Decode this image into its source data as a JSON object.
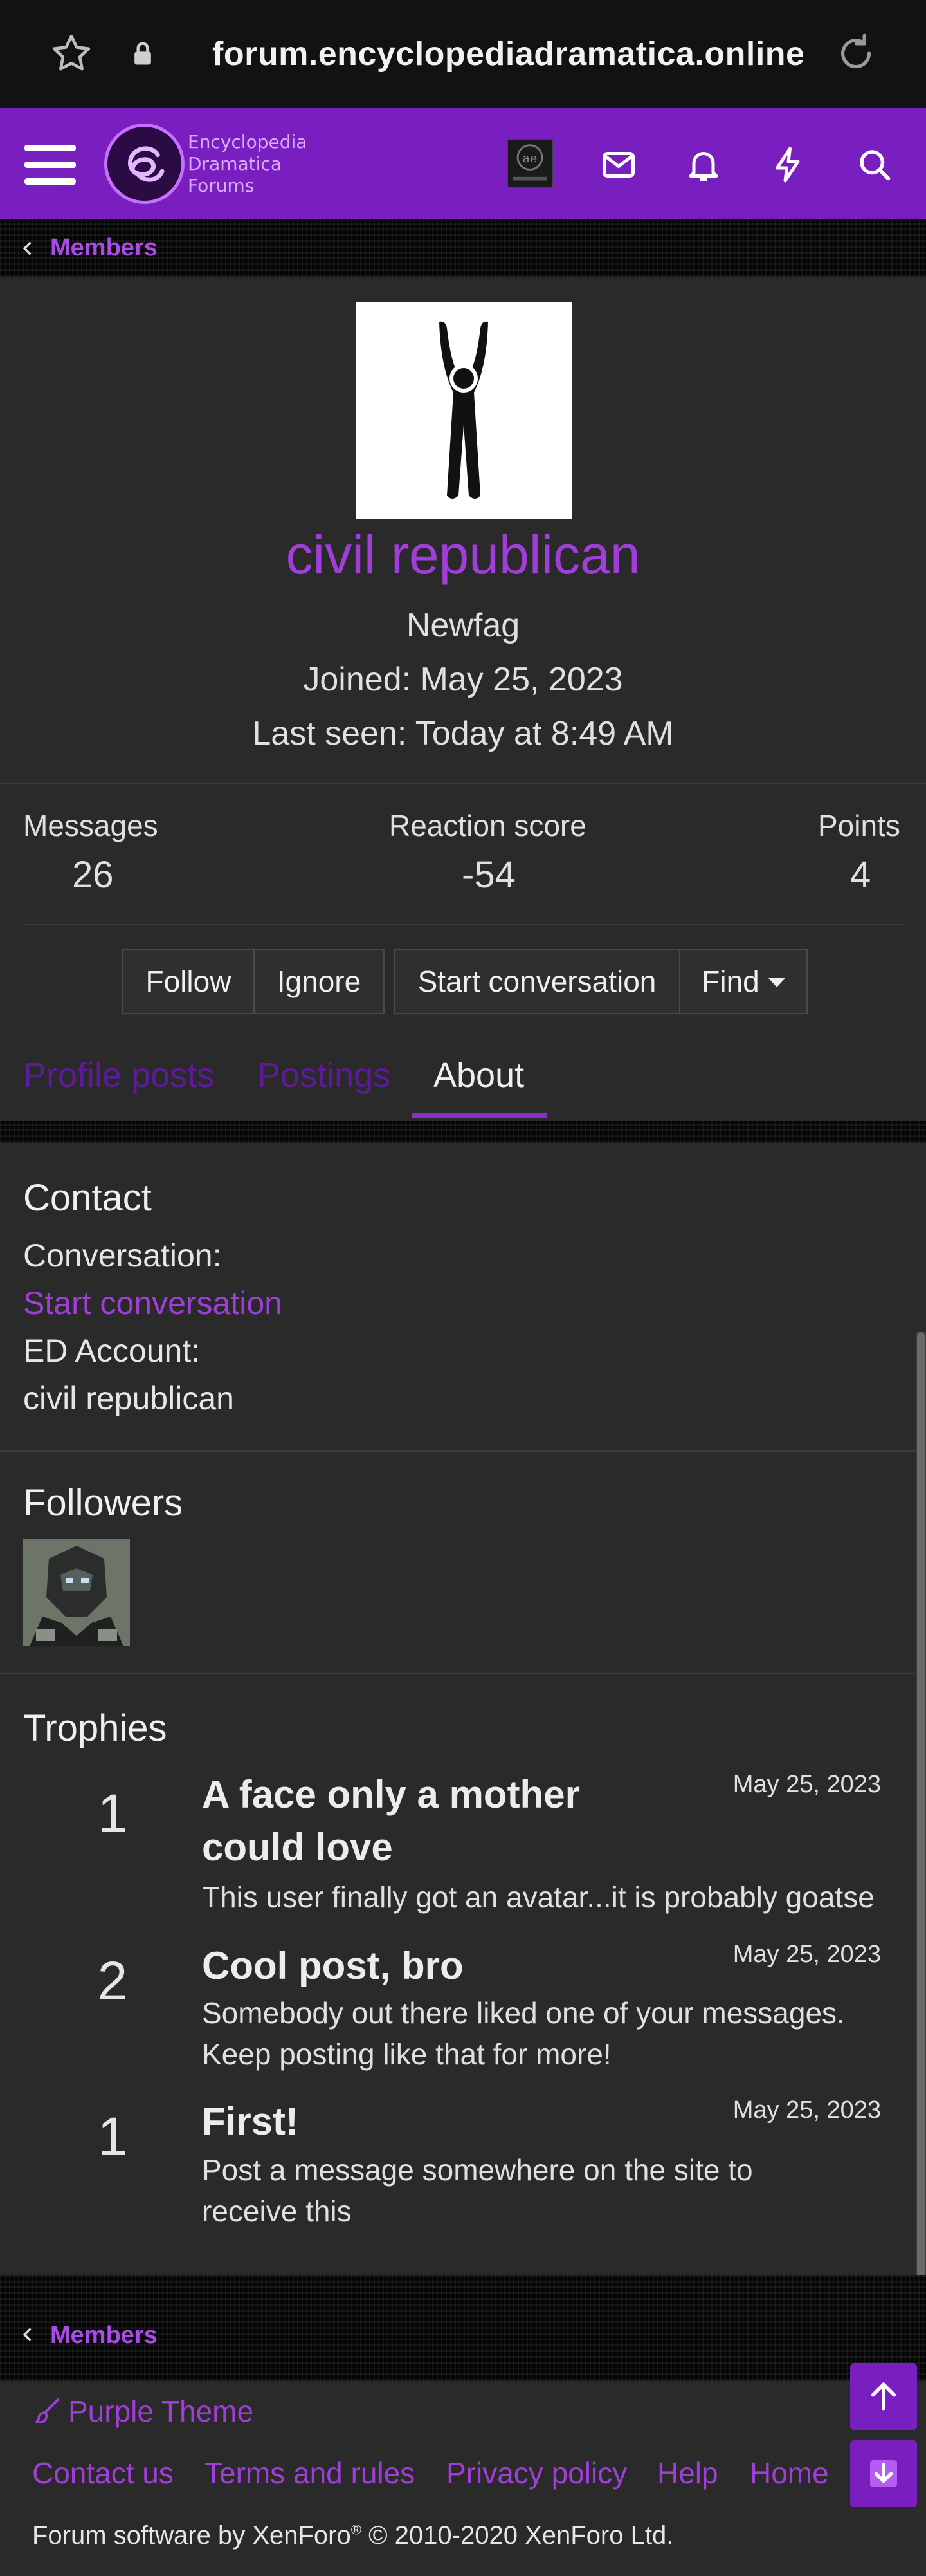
{
  "browser": {
    "url": "forum.encyclopediadramatica.online"
  },
  "header": {
    "logo_lines": [
      "Encyclopedia",
      "Dramatica",
      "Forums"
    ],
    "logo_mark": "ae"
  },
  "breadcrumb": {
    "label": "Members"
  },
  "profile": {
    "username": "civil republican",
    "user_title": "Newfag",
    "joined": "Joined: May 25, 2023",
    "last_seen": "Last seen: Today at 8:49 AM",
    "stats": [
      {
        "label": "Messages",
        "value": "26"
      },
      {
        "label": "Reaction score",
        "value": "-54"
      },
      {
        "label": "Points",
        "value": "4"
      }
    ]
  },
  "actions": {
    "follow": "Follow",
    "ignore": "Ignore",
    "start_conversation": "Start conversation",
    "find": "Find"
  },
  "tabs": [
    {
      "label": "Profile posts",
      "active": false
    },
    {
      "label": "Postings",
      "active": false
    },
    {
      "label": "About",
      "active": true
    }
  ],
  "contact": {
    "title": "Contact",
    "conversation_label": "Conversation:",
    "conversation_link": "Start conversation",
    "ed_account_label": "ED Account:",
    "ed_account_value": "civil republican"
  },
  "followers": {
    "title": "Followers"
  },
  "trophies": {
    "title": "Trophies",
    "items": [
      {
        "points": "1",
        "title": "A face only a mother could love",
        "date": "May 25, 2023",
        "desc": "This user finally got an avatar...it is probably goatse"
      },
      {
        "points": "2",
        "title": "Cool post, bro",
        "date": "May 25, 2023",
        "desc": "Somebody out there liked one of your messages. Keep posting like that for more!"
      },
      {
        "points": "1",
        "title": "First!",
        "date": "May 25, 2023",
        "desc": "Post a message somewhere on the site to receive this"
      }
    ]
  },
  "footer": {
    "theme": "Purple Theme",
    "links": [
      "Contact us",
      "Terms and rules",
      "Privacy policy",
      "Help",
      "Home"
    ],
    "copyright_pre": "Forum software by XenForo",
    "copyright_reg": "®",
    "copyright_post": " © 2010-2020 XenForo Ltd."
  },
  "colors": {
    "brand": "#7a1fbf",
    "link": "#a13ed9",
    "background": "#2a2a2a"
  },
  "icons": [
    "star-icon",
    "lock-icon",
    "reload-icon",
    "menu-icon",
    "mail-icon",
    "bell-icon",
    "bolt-icon",
    "search-icon",
    "chevron-left-icon",
    "brush-icon",
    "arrow-up-icon",
    "arrow-down-icon"
  ]
}
